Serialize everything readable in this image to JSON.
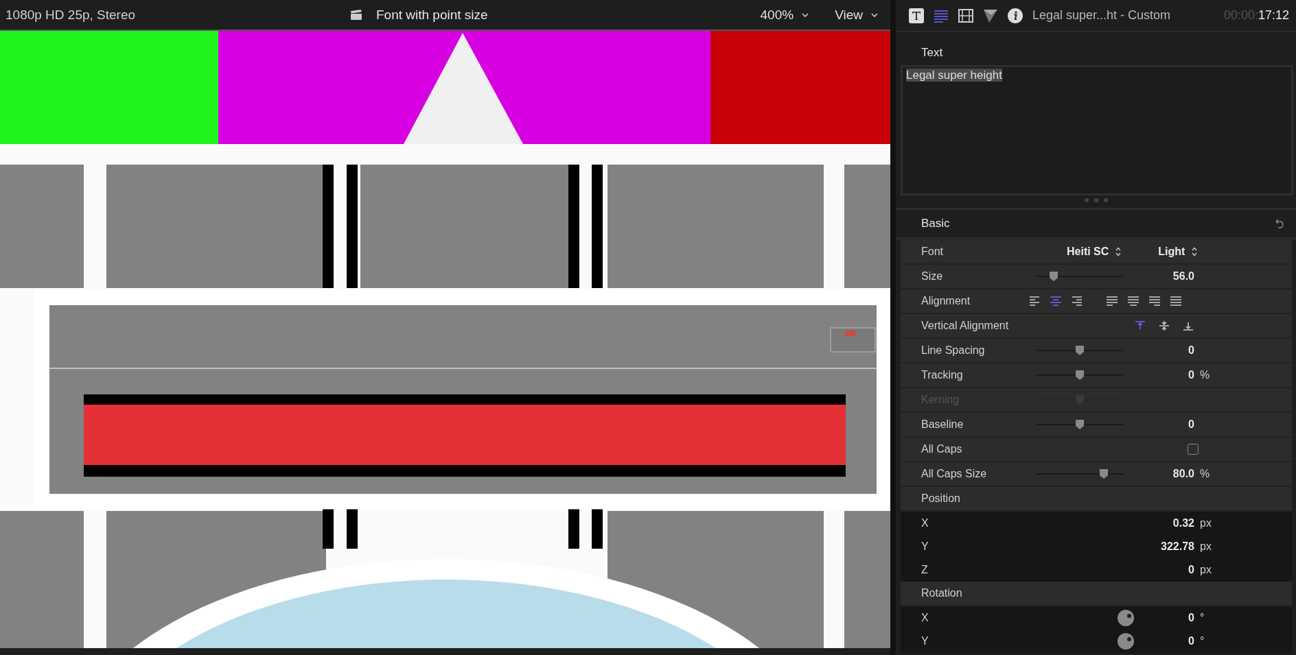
{
  "viewer": {
    "format": "1080p HD 25p, Stereo",
    "title": "Font with point size",
    "zoom": "400%",
    "view_menu": "View"
  },
  "inspector": {
    "tabs": [
      {
        "kind": "title",
        "selected": false
      },
      {
        "kind": "text",
        "selected": true
      },
      {
        "kind": "video",
        "selected": false
      },
      {
        "kind": "filter",
        "selected": false
      },
      {
        "kind": "info",
        "selected": false
      }
    ],
    "title": "Legal super...ht - Custom",
    "timecode": {
      "dim": "00:00:",
      "main": "17:12"
    },
    "text_section": {
      "heading": "Text",
      "value": "Legal super height"
    },
    "basic": {
      "heading": "Basic",
      "rows": [
        {
          "kind": "popup",
          "label": "Font",
          "values": [
            "Heiti SC",
            "Light"
          ]
        },
        {
          "kind": "slider",
          "label": "Size",
          "level": 0.2,
          "value": "56.0"
        },
        {
          "kind": "align",
          "label": "Alignment",
          "options": [
            {
              "kind": "left",
              "selected": false
            },
            {
              "kind": "center",
              "selected": true
            },
            {
              "kind": "right",
              "selected": false
            },
            {
              "kind": "justify-left",
              "selected": false
            },
            {
              "kind": "justify-center",
              "selected": false
            },
            {
              "kind": "justify-right",
              "selected": false
            },
            {
              "kind": "justify-full",
              "selected": false
            }
          ]
        },
        {
          "kind": "valign",
          "label": "Vertical Alignment",
          "options": [
            {
              "kind": "top",
              "selected": true
            },
            {
              "kind": "middle",
              "selected": false
            },
            {
              "kind": "bottom",
              "selected": false
            }
          ]
        },
        {
          "kind": "slider",
          "label": "Line Spacing",
          "level": 0.5,
          "value": "0"
        },
        {
          "kind": "slider",
          "label": "Tracking",
          "level": 0.5,
          "value": "0",
          "unit": "%"
        },
        {
          "kind": "slider",
          "label": "Kerning",
          "level": 0.5,
          "disabled": true
        },
        {
          "kind": "slider",
          "label": "Baseline",
          "level": 0.5,
          "value": "0"
        },
        {
          "kind": "checkbox",
          "label": "All Caps",
          "checked": false
        },
        {
          "kind": "slider",
          "label": "All Caps Size",
          "level": 0.78,
          "value": "80.0",
          "unit": "%"
        },
        {
          "kind": "group",
          "label": "Position"
        },
        {
          "kind": "field",
          "label": "X",
          "value": "0.32",
          "unit": "px"
        },
        {
          "kind": "field",
          "label": "Y",
          "value": "322.78",
          "unit": "px"
        },
        {
          "kind": "field",
          "label": "Z",
          "value": "0",
          "unit": "px"
        },
        {
          "kind": "group",
          "label": "Rotation"
        },
        {
          "kind": "dial",
          "label": "X",
          "value": "0",
          "unit": "°"
        },
        {
          "kind": "dial",
          "label": "Y",
          "value": "0",
          "unit": "°"
        }
      ]
    }
  }
}
